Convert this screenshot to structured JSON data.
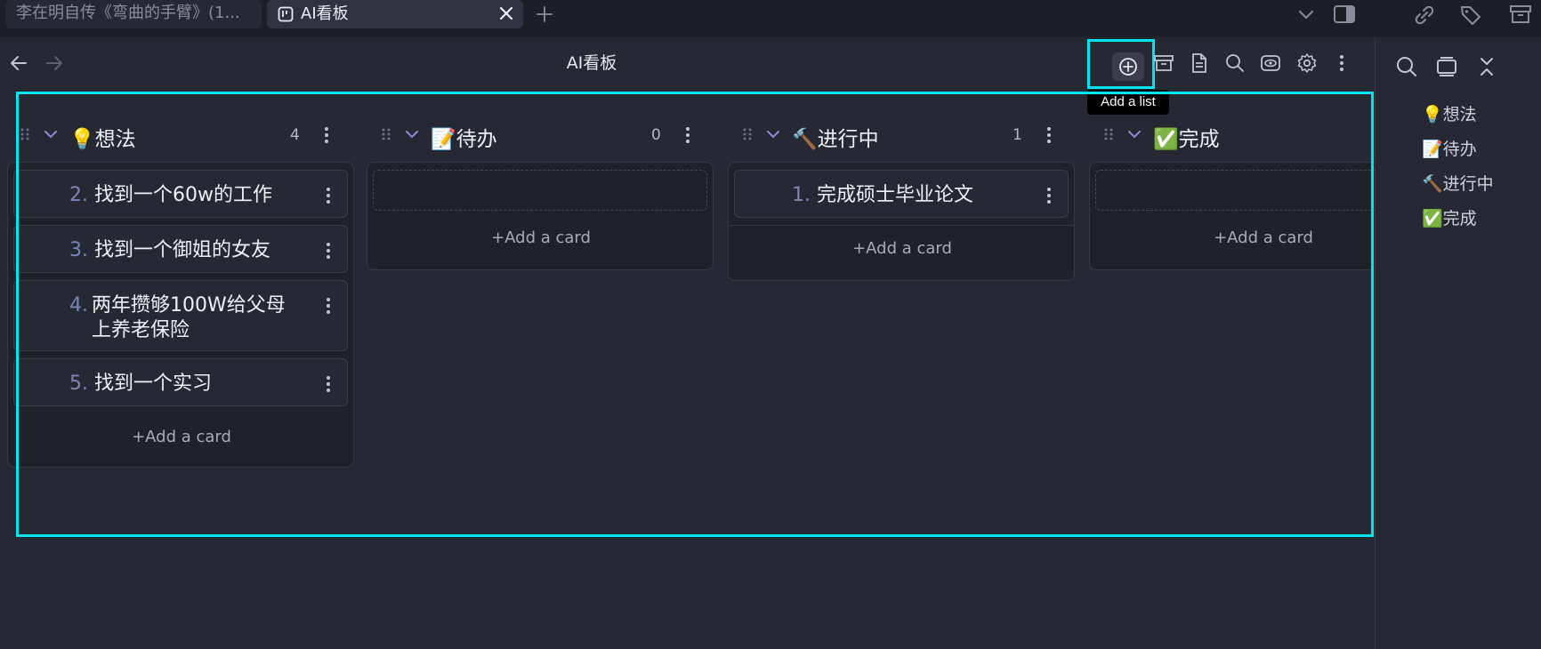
{
  "tabs": {
    "inactive_title": "李在明自传《弯曲的手臂》(1...",
    "active_title": "AI看板"
  },
  "view": {
    "title": "AI看板",
    "tooltip": "Add a list"
  },
  "colors": {
    "accent_highlight": "#00e5ee",
    "background": "#262934",
    "card_number": "#7e86b3"
  },
  "lanes": [
    {
      "title": "💡想法",
      "count": "4",
      "cards": [
        {
          "num": "2.",
          "text": "找到一个60w的工作"
        },
        {
          "num": "3.",
          "text": "找到一个御姐的女友"
        },
        {
          "num": "4.",
          "text": "两年攒够100W给父母上养老保险"
        },
        {
          "num": "5.",
          "text": "找到一个实习"
        }
      ],
      "add_card": "+Add a card"
    },
    {
      "title": "📝待办",
      "count": "0",
      "cards": [],
      "add_card": "+Add a card"
    },
    {
      "title": "🔨进行中",
      "count": "1",
      "cards": [
        {
          "num": "1.",
          "text": "完成硕士毕业论文"
        }
      ],
      "add_card": "+Add a card"
    },
    {
      "title": "✅完成",
      "count": "",
      "cards": [],
      "add_card": "+Add a card"
    }
  ],
  "outline": {
    "items": [
      "💡想法",
      "📝待办",
      "🔨进行中",
      "✅完成"
    ]
  },
  "icons": {
    "header": [
      "back-arrow-icon",
      "forward-arrow-icon",
      "add-list-icon",
      "archive-icon",
      "markdown-file-icon",
      "search-icon",
      "view-toggle-icon",
      "settings-gear-icon",
      "more-vertical-icon"
    ],
    "right_panel": [
      "search-icon",
      "outline-icon",
      "collapse-icon"
    ]
  }
}
